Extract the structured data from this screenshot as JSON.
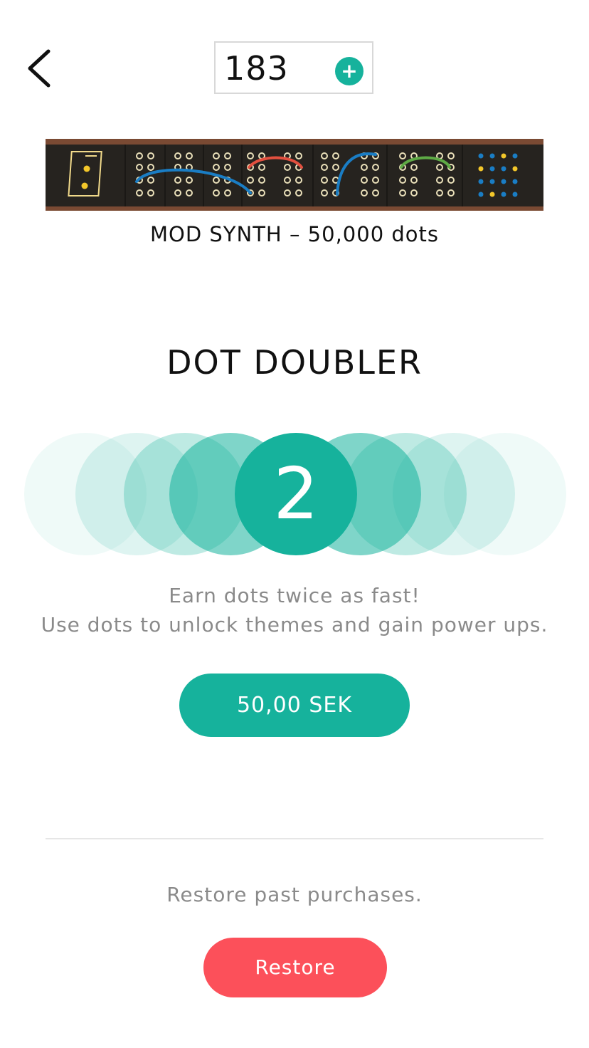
{
  "header": {
    "back_icon": "chevron-left-icon",
    "dots_count": "183",
    "add_icon": "plus-icon"
  },
  "theme_banner": {
    "caption": "MOD SYNTH – 50,000 dots"
  },
  "product": {
    "title": "DOT DOUBLER",
    "multiplier": "2",
    "description_line1": "Earn dots twice as fast!",
    "description_line2": "Use dots to unlock themes and gain power ups.",
    "price_label": "50,00 SEK"
  },
  "restore": {
    "prompt": "Restore past purchases.",
    "button_label": "Restore"
  },
  "colors": {
    "accent": "#16b29c",
    "restore": "#fc505a",
    "text_muted": "#8a8a8a",
    "banner_bg": "#26231f",
    "banner_trim": "#7a4a33"
  }
}
